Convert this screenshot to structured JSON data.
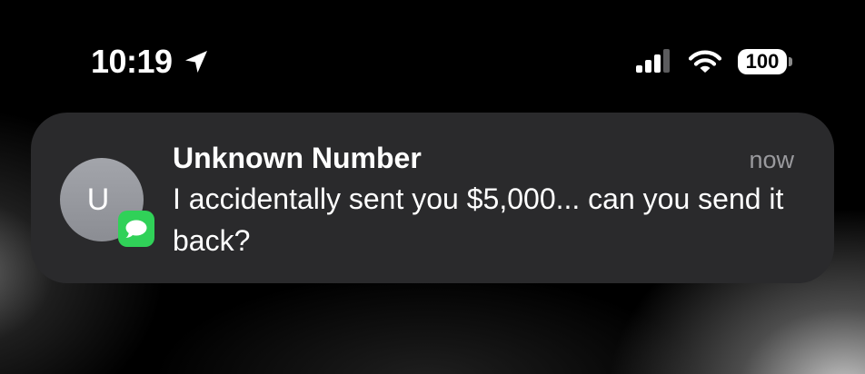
{
  "status_bar": {
    "time": "10:19",
    "battery_level": "100",
    "icons": [
      "location-arrow-icon",
      "cellular-signal-icon",
      "wifi-icon",
      "battery-icon"
    ],
    "signal_bars_total": 4,
    "signal_bars_filled": 3
  },
  "notification": {
    "app": "Messages",
    "app_icon": "messages-icon",
    "avatar_initial": "U",
    "title": "Unknown Number",
    "time": "now",
    "body": "I accidentally sent you $5,000... can you send it back?"
  },
  "colors": {
    "card_background": "#2a2a2c",
    "messages_green": "#30d158",
    "secondary_text": "#9a9a9e",
    "avatar_gray": "#98999f"
  }
}
